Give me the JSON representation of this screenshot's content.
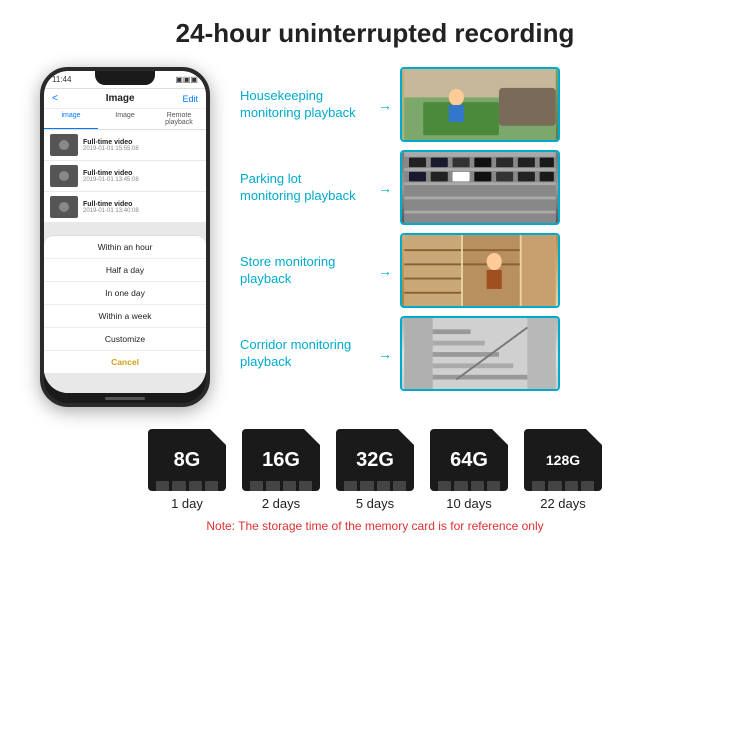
{
  "page": {
    "title": "24-hour uninterrupted recording"
  },
  "phone": {
    "status_time": "11:44",
    "header_title": "Image",
    "header_back": "<",
    "header_edit": "Edit",
    "tabs": [
      "image",
      "Image",
      "Remote playback"
    ],
    "videos": [
      {
        "label": "Full-time video",
        "date": "2019-01-01 15:55:08"
      },
      {
        "label": "Full-time video",
        "date": "2019-01-01 13:45:08"
      },
      {
        "label": "Full-time video",
        "date": "2019-01-01 13:40:08"
      }
    ],
    "dropdown_items": [
      "Within an hour",
      "Half a day",
      "In one day",
      "Within a week",
      "Customize"
    ],
    "cancel_label": "Cancel"
  },
  "monitoring": [
    {
      "label": "Housekeeping\nmonitoring playback",
      "img_type": "housekeeping"
    },
    {
      "label": "Parking lot\nmonitoring playback",
      "img_type": "parking"
    },
    {
      "label": "Store monitoring\nplayback",
      "img_type": "store"
    },
    {
      "label": "Corridor monitoring\nplayback",
      "img_type": "corridor"
    }
  ],
  "memory_cards": [
    {
      "size": "8G",
      "days": "1 day"
    },
    {
      "size": "16G",
      "days": "2 days"
    },
    {
      "size": "32G",
      "days": "5 days"
    },
    {
      "size": "64G",
      "days": "10 days"
    },
    {
      "size": "128G",
      "days": "22 days"
    }
  ],
  "note": "Note: The storage time of the memory card is for reference only"
}
